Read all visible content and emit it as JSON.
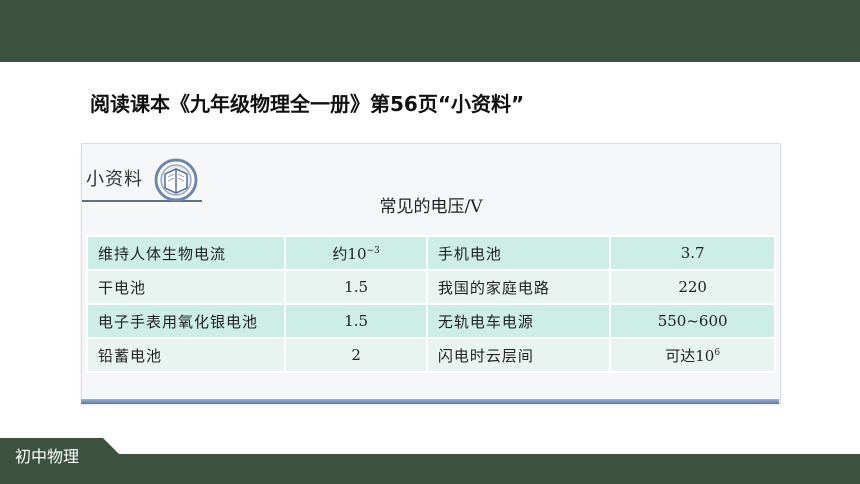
{
  "heading": "阅读课本《九年级物理全一册》第56页“小资料”",
  "sidebar_label": "小资料",
  "table_title": "常见的电压/V",
  "rows": [
    {
      "n1": "维持人体生物电流",
      "v1": "约10",
      "v1sup": "−3",
      "n2": "手机电池",
      "v2": "3.7",
      "v2sup": ""
    },
    {
      "n1": "干电池",
      "v1": "1.5",
      "v1sup": "",
      "n2": "我国的家庭电路",
      "v2": "220",
      "v2sup": ""
    },
    {
      "n1": "电子手表用氧化银电池",
      "v1": "1.5",
      "v1sup": "",
      "n2": "无轨电车电源",
      "v2": "550~600",
      "v2sup": ""
    },
    {
      "n1": "铅蓄电池",
      "v1": "2",
      "v1sup": "",
      "n2": "闪电时云层间",
      "v2": "可达10",
      "v2sup": "6"
    }
  ],
  "footer": {
    "label": "初中物理"
  },
  "colors": {
    "bar": "#3b5240",
    "row_odd": "#cdeee6",
    "row_even": "#e9f4f1"
  },
  "icons": [
    "book-icon"
  ]
}
